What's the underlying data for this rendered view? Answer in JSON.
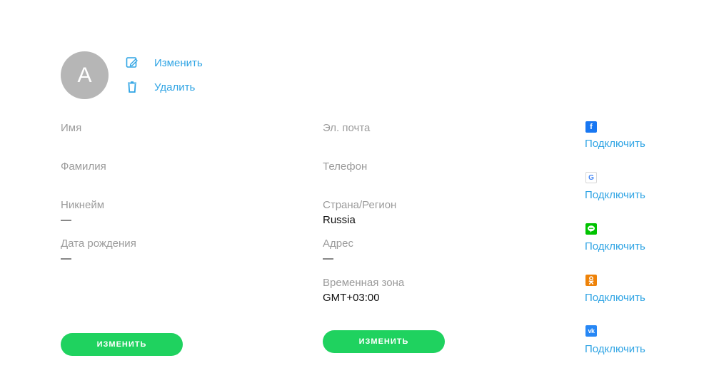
{
  "avatar": {
    "letter": "A",
    "edit_label": "Изменить",
    "delete_label": "Удалить",
    "edit_icon": "edit-icon",
    "delete_icon": "trash-icon"
  },
  "personal": {
    "first_name": {
      "label": "Имя",
      "value": ""
    },
    "last_name": {
      "label": "Фамилия",
      "value": ""
    },
    "nickname": {
      "label": "Никнейм",
      "value": "—"
    },
    "birthdate": {
      "label": "Дата рождения",
      "value": "—"
    },
    "button_label": "ИЗМЕНИТЬ"
  },
  "contact": {
    "email": {
      "label": "Эл. почта",
      "value": ""
    },
    "phone": {
      "label": "Телефон",
      "value": ""
    },
    "country": {
      "label": "Страна/Регион",
      "value": "Russia"
    },
    "address": {
      "label": "Адрес",
      "value": "—"
    },
    "timezone": {
      "label": "Временная зона",
      "value": "GMT+03:00"
    },
    "button_label": "ИЗМЕНИТЬ"
  },
  "social": [
    {
      "service": "facebook",
      "icon": "facebook-icon",
      "glyph": "f",
      "color": "#3b5998",
      "link": "Подключить"
    },
    {
      "service": "google",
      "icon": "google-icon",
      "glyph": "G",
      "color": "#4285f4",
      "link": "Подключить"
    },
    {
      "service": "line",
      "icon": "line-icon",
      "glyph": "",
      "color": "#00c300",
      "link": "Подключить"
    },
    {
      "service": "odnoklassniki",
      "icon": "odnoklassniki-icon",
      "glyph": "",
      "color": "#ee8208",
      "link": "Подключить"
    },
    {
      "service": "vk",
      "icon": "vk-icon",
      "glyph": "vk",
      "color": "#4a76a8",
      "link": "Подключить"
    }
  ],
  "colors": {
    "accent_link": "#2fa4e4",
    "button_green": "#1fd25f",
    "label_gray": "#9b9b9b",
    "avatar_gray": "#b6b6b6"
  }
}
